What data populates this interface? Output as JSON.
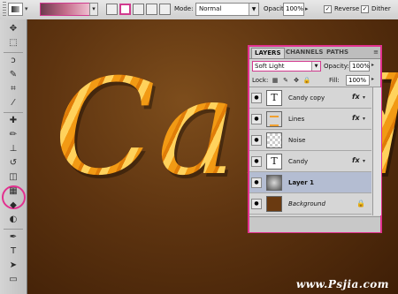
{
  "options_bar": {
    "tool_icon": "gradient-tool-icon",
    "gradient_dropdown_arrow": "▾",
    "gradient_types": [
      "linear-gradient-icon",
      "radial-gradient-icon",
      "angle-gradient-icon",
      "reflected-gradient-icon",
      "diamond-gradient-icon"
    ],
    "mode_label": "Mode:",
    "mode_value": "Normal",
    "opacity_label": "Opacity:",
    "opacity_value": "100%",
    "reverse_label": "Reverse",
    "dither_label": "Dither",
    "checkmark": "✓",
    "colors": {
      "gradient_start": "#6e3a4e",
      "gradient_end": "#f1c2d3",
      "highlight": "#e2318f"
    }
  },
  "toolbox": {
    "tools": [
      {
        "name": "move-tool-icon",
        "glyph": "✥"
      },
      {
        "name": "marquee-tool-icon",
        "glyph": "⬚"
      },
      {
        "name": "lasso-tool-icon",
        "glyph": "ↄ"
      },
      {
        "name": "quick-select-tool-icon",
        "glyph": "✎"
      },
      {
        "name": "crop-tool-icon",
        "glyph": "⌗"
      },
      {
        "name": "eyedropper-tool-icon",
        "glyph": "⁄"
      },
      {
        "name": "healing-brush-tool-icon",
        "glyph": "✚"
      },
      {
        "name": "brush-tool-icon",
        "glyph": "✏"
      },
      {
        "name": "clone-stamp-tool-icon",
        "glyph": "⊥"
      },
      {
        "name": "history-brush-tool-icon",
        "glyph": "↺"
      },
      {
        "name": "eraser-tool-icon",
        "glyph": "◫"
      },
      {
        "name": "gradient-tool-icon",
        "glyph": "▦"
      },
      {
        "name": "blur-tool-icon",
        "glyph": "◆"
      },
      {
        "name": "dodge-tool-icon",
        "glyph": "◐"
      },
      {
        "name": "pen-tool-icon",
        "glyph": "✒"
      },
      {
        "name": "type-tool-icon",
        "glyph": "T"
      },
      {
        "name": "path-select-tool-icon",
        "glyph": "➤"
      },
      {
        "name": "shape-tool-icon",
        "glyph": "▭"
      }
    ]
  },
  "canvas": {
    "text": "Candy",
    "colors": {
      "background": "#5e3410",
      "text_fill": "#f2a11a"
    }
  },
  "layers_panel": {
    "tabs": [
      "LAYERS",
      "CHANNELS",
      "PATHS"
    ],
    "active_tab": "LAYERS",
    "menu_icon": "≡",
    "blend_mode": "Soft Light",
    "opacity_label": "Opacity:",
    "opacity_value": "100%",
    "lock_label": "Lock:",
    "lock_icons": [
      {
        "name": "lock-transparent-icon",
        "glyph": "▦"
      },
      {
        "name": "lock-pixels-icon",
        "glyph": "✎"
      },
      {
        "name": "lock-position-icon",
        "glyph": "✥"
      },
      {
        "name": "lock-all-icon",
        "glyph": "🔒"
      }
    ],
    "fill_label": "Fill:",
    "fill_value": "100%",
    "layers": [
      {
        "name": "Candy copy",
        "thumb": "text",
        "thumb_glyph": "T",
        "fx": true,
        "selected": false,
        "style": ""
      },
      {
        "name": "Lines",
        "thumb": "lines",
        "thumb_glyph": "",
        "fx": true,
        "selected": false,
        "style": ""
      },
      {
        "name": "Noise",
        "thumb": "checker",
        "thumb_glyph": "",
        "fx": false,
        "selected": false,
        "style": ""
      },
      {
        "name": "Candy",
        "thumb": "text",
        "thumb_glyph": "T",
        "fx": true,
        "selected": false,
        "style": ""
      },
      {
        "name": "Layer 1",
        "thumb": "dark",
        "thumb_glyph": "",
        "fx": false,
        "selected": true,
        "style": "bold"
      },
      {
        "name": "Background",
        "thumb": "brown",
        "thumb_glyph": "",
        "fx": false,
        "selected": false,
        "style": "italic",
        "locked": true
      }
    ],
    "fx_label": "fx",
    "fx_arrow": "▾",
    "eye_glyph": "●",
    "lock_glyph": "🔒"
  },
  "watermark": "www.Psjia.com"
}
